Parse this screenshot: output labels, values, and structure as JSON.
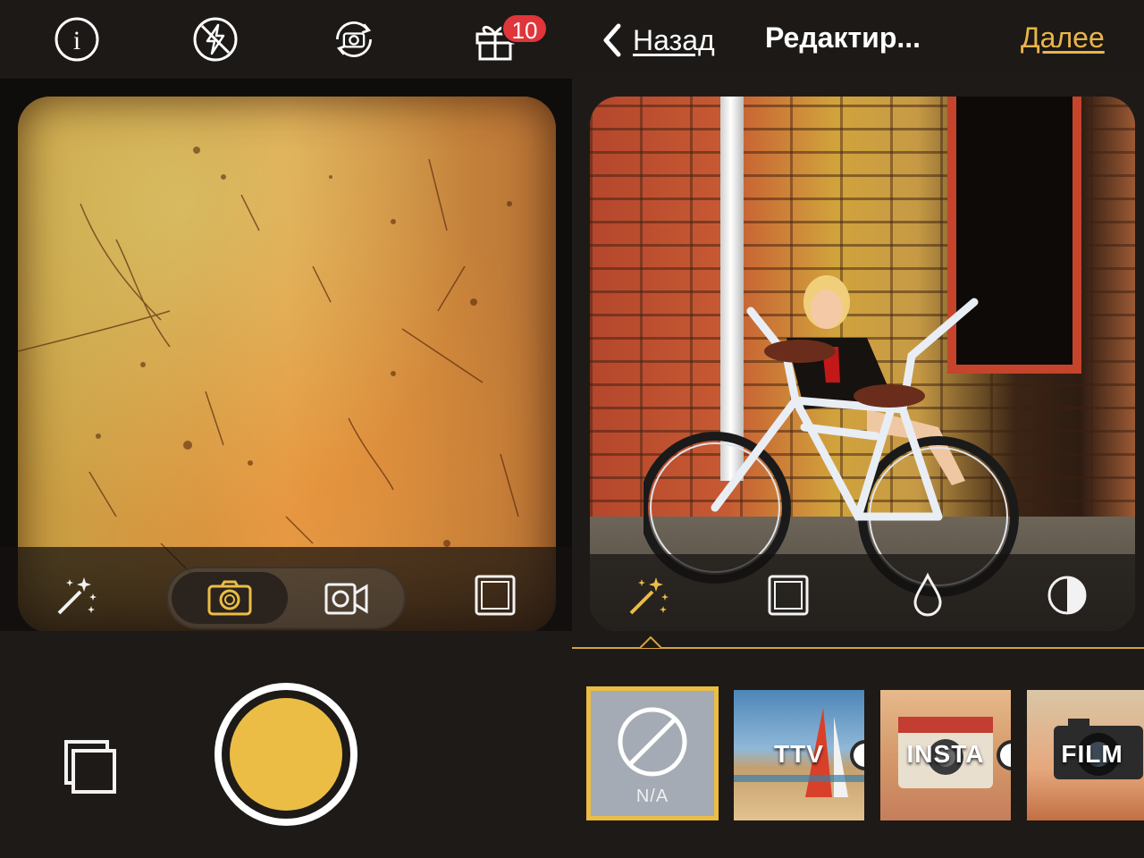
{
  "left": {
    "topbar": {
      "icons": [
        "info-icon",
        "flash-off-icon",
        "switch-camera-icon",
        "gift-icon"
      ],
      "gift_badge": "10"
    },
    "controls": {
      "magic": "magic-wand-icon",
      "mode_photo": "camera-icon",
      "mode_video": "video-camera-icon",
      "frame": "frame-icon",
      "selected_mode": "photo"
    },
    "bottom": {
      "gallery": "gallery-icon",
      "shutter": "shutter-button"
    }
  },
  "right": {
    "navbar": {
      "back_label": "Назад",
      "title": "Редактир...",
      "next_label": "Далее"
    },
    "tools": [
      "magic-wand-icon",
      "frame-icon",
      "drop-icon",
      "contrast-icon"
    ],
    "selected_tool": "magic-wand-icon",
    "filters": [
      {
        "label": "N/A",
        "selected": true
      },
      {
        "label": "TTV",
        "selected": false
      },
      {
        "label": "INSTA",
        "selected": false
      },
      {
        "label": "FILM",
        "selected": false
      }
    ]
  },
  "colors": {
    "accent": "#ebbd44",
    "badge": "#e0353b",
    "background": "#1e1a17"
  }
}
